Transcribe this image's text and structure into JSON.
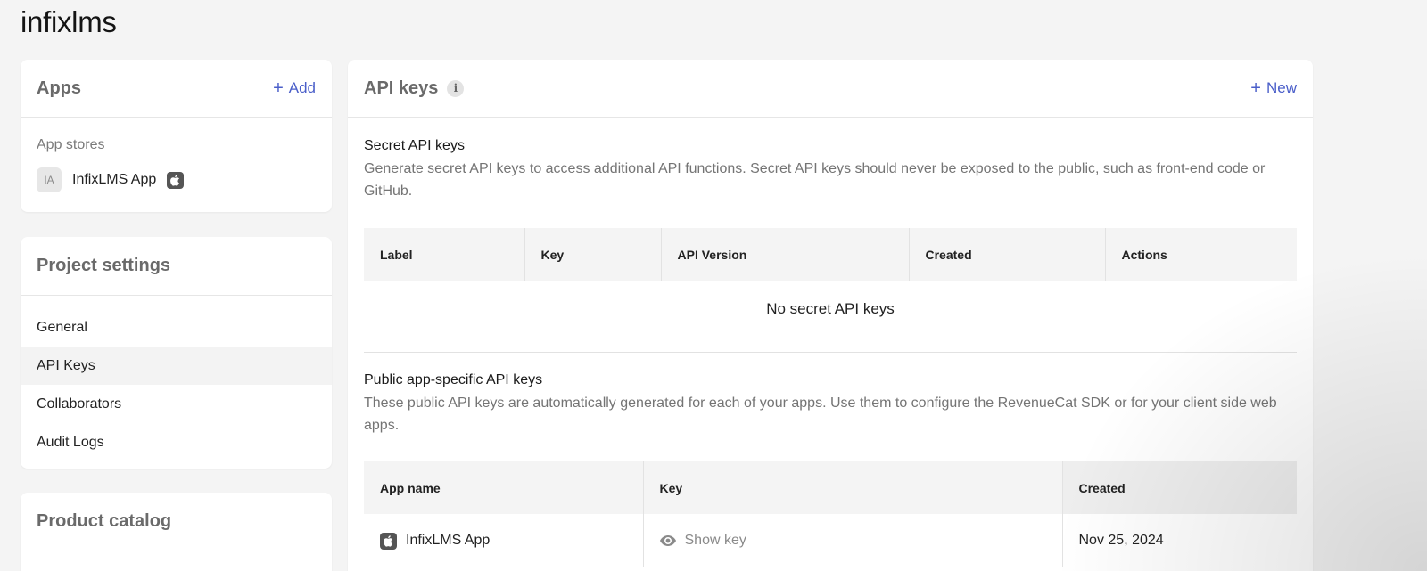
{
  "project": {
    "title": "infixlms"
  },
  "apps_card": {
    "title": "Apps",
    "add_label": "Add",
    "stores_label": "App stores",
    "apps": [
      {
        "initials": "IA",
        "name": "InfixLMS App",
        "platform_icon": "apple-icon"
      }
    ]
  },
  "settings_card": {
    "title": "Project settings",
    "items": [
      {
        "label": "General"
      },
      {
        "label": "API Keys",
        "active": true
      },
      {
        "label": "Collaborators"
      },
      {
        "label": "Audit Logs"
      }
    ]
  },
  "catalog_card": {
    "title": "Product catalog"
  },
  "api_keys": {
    "title": "API keys",
    "new_label": "New",
    "secret": {
      "title": "Secret API keys",
      "description": "Generate secret API keys to access additional API functions. Secret API keys should never be exposed to the public, such as front-end code or GitHub.",
      "columns": [
        "Label",
        "Key",
        "API Version",
        "Created",
        "Actions"
      ],
      "empty_text": "No secret API keys"
    },
    "public": {
      "title": "Public app-specific API keys",
      "description": "These public API keys are automatically generated for each of your apps. Use them to configure the RevenueCat SDK or for your client side web apps.",
      "columns": [
        "App name",
        "Key",
        "Created"
      ],
      "rows": [
        {
          "app_name": "InfixLMS App",
          "key_action": "Show key",
          "created": "Nov 25, 2024"
        }
      ]
    }
  },
  "colors": {
    "accent": "#4a5ec9",
    "background": "#f4f4f4"
  }
}
